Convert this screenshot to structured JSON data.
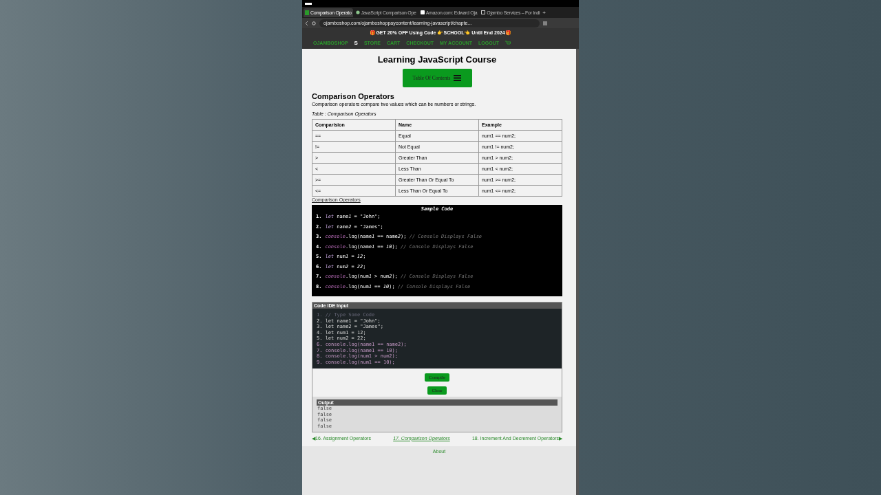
{
  "browser": {
    "tabs": [
      {
        "title": "Comparison Operato",
        "selected": true
      },
      {
        "title": "JavaScript Comparison Ope",
        "selected": false
      },
      {
        "title": "Amazon.com: Edward Oja",
        "selected": false
      },
      {
        "title": "Ojambo Services – For Indi",
        "selected": false
      }
    ],
    "new_tab": "+",
    "url": "ojamboshop.com/ojamboshoppaycontent/learning-javascript/chapte..."
  },
  "promo": "🎁GET 20% OFF Using Code 👉SCHOOL👈 Until End 2024🎁",
  "nav": {
    "brand": "OJAMBOSHOP",
    "brand_mark": "S",
    "links": [
      "STORE",
      "CART",
      "CHECKOUT",
      "MY ACCOUNT",
      "LOGOUT"
    ]
  },
  "page": {
    "title": "Learning JavaScript Course",
    "toc_button": "Table Of Contents",
    "heading": "Comparison Operators",
    "intro": "Comparison operators compare two values which can be numbers or strings.",
    "table_caption": "Table : Comparison Operators",
    "table": {
      "columns": [
        "Comparision",
        "Name",
        "Example"
      ],
      "rows": [
        [
          "==",
          "Equal",
          "num1 == num2;"
        ],
        [
          "!=",
          "Not Equal",
          "num1 != num2;"
        ],
        [
          ">",
          "Greater Than",
          "num1 > num2;"
        ],
        [
          "<",
          "Less Than",
          "num1 < num2;"
        ],
        [
          ">=",
          "Greater Than Or Equal To",
          "num1 >= num2;"
        ],
        [
          "<=",
          "Less Than Or Equal To",
          "num1 <= num2;"
        ]
      ]
    },
    "table_link": "Comparison Operators",
    "sample": {
      "title": "Sample Code",
      "lines": [
        {
          "num": "1.",
          "tokens": [
            {
              "kind": "keyword",
              "text": "let"
            },
            {
              "kind": "plain",
              "text": " name"
            },
            {
              "kind": "number",
              "text": "1"
            },
            {
              "kind": "plain",
              "text": " = \"John\";"
            }
          ]
        },
        {
          "num": "2.",
          "tokens": [
            {
              "kind": "keyword",
              "text": "let"
            },
            {
              "kind": "plain",
              "text": " name"
            },
            {
              "kind": "number",
              "text": "2"
            },
            {
              "kind": "plain",
              "text": " = \"James\";"
            }
          ]
        },
        {
          "num": "3.",
          "tokens": [
            {
              "kind": "object",
              "text": "console"
            },
            {
              "kind": "plain",
              "text": ".log(name"
            },
            {
              "kind": "number",
              "text": "1"
            },
            {
              "kind": "plain",
              "text": " == name"
            },
            {
              "kind": "number",
              "text": "2"
            },
            {
              "kind": "plain",
              "text": ");"
            },
            {
              "kind": "comment",
              "text": " // Console Displays False"
            }
          ]
        },
        {
          "num": "4.",
          "tokens": [
            {
              "kind": "object",
              "text": "console"
            },
            {
              "kind": "plain",
              "text": ".log(name"
            },
            {
              "kind": "number",
              "text": "1"
            },
            {
              "kind": "plain",
              "text": " == "
            },
            {
              "kind": "number",
              "text": "10"
            },
            {
              "kind": "plain",
              "text": ");"
            },
            {
              "kind": "comment",
              "text": " // Console Displays False"
            }
          ]
        },
        {
          "num": "5.",
          "tokens": [
            {
              "kind": "keyword",
              "text": "let"
            },
            {
              "kind": "plain",
              "text": " num"
            },
            {
              "kind": "number",
              "text": "1"
            },
            {
              "kind": "plain",
              "text": " = "
            },
            {
              "kind": "number",
              "text": "12"
            },
            {
              "kind": "plain",
              "text": ";"
            }
          ]
        },
        {
          "num": "6.",
          "tokens": [
            {
              "kind": "keyword",
              "text": "let"
            },
            {
              "kind": "plain",
              "text": " num"
            },
            {
              "kind": "number",
              "text": "2"
            },
            {
              "kind": "plain",
              "text": " = "
            },
            {
              "kind": "number",
              "text": "22"
            },
            {
              "kind": "plain",
              "text": ";"
            }
          ]
        },
        {
          "num": "7.",
          "tokens": [
            {
              "kind": "object",
              "text": "console"
            },
            {
              "kind": "plain",
              "text": ".log(num"
            },
            {
              "kind": "number",
              "text": "1"
            },
            {
              "kind": "plain",
              "text": " > num"
            },
            {
              "kind": "number",
              "text": "2"
            },
            {
              "kind": "plain",
              "text": ");"
            },
            {
              "kind": "comment",
              "text": " // Console Displays False"
            }
          ]
        },
        {
          "num": "8.",
          "tokens": [
            {
              "kind": "object",
              "text": "console"
            },
            {
              "kind": "plain",
              "text": ".log(num"
            },
            {
              "kind": "number",
              "text": "1"
            },
            {
              "kind": "plain",
              "text": " == "
            },
            {
              "kind": "number",
              "text": "10"
            },
            {
              "kind": "plain",
              "text": ");"
            },
            {
              "kind": "comment",
              "text": " // Console Displays False"
            }
          ]
        }
      ]
    },
    "ide": {
      "title": "Code IDE Input",
      "lines": [
        {
          "num": "1.",
          "kind": "comment",
          "text": "// Type Some Code"
        },
        {
          "num": "2.",
          "kind": "plain",
          "text": "let name1 = \"John\";"
        },
        {
          "num": "3.",
          "kind": "plain",
          "text": "let name2 = \"James\";"
        },
        {
          "num": "4.",
          "kind": "plain",
          "text": "let num1 = 12;"
        },
        {
          "num": "5.",
          "kind": "plain",
          "text": "let num2 = 22;"
        },
        {
          "num": "6.",
          "kind": "call",
          "text": "console.log(name1 == name2);"
        },
        {
          "num": "7.",
          "kind": "call",
          "text": "console.log(name1 == 10);"
        },
        {
          "num": "8.",
          "kind": "call",
          "text": "console.log(num1 > num2);"
        },
        {
          "num": "9.",
          "kind": "call",
          "text": "console.log(num1 == 10);"
        }
      ],
      "compile_button": "Compile",
      "clear_button": "Clear",
      "output_title": "Output",
      "output": [
        "false",
        "false",
        "false",
        "false"
      ]
    },
    "pager": {
      "prev": "◀16. Assignment Operators",
      "current": "17. Comparison Operators",
      "next": "18. Increment And Decrement Operators▶"
    },
    "footer": [
      "About"
    ]
  }
}
